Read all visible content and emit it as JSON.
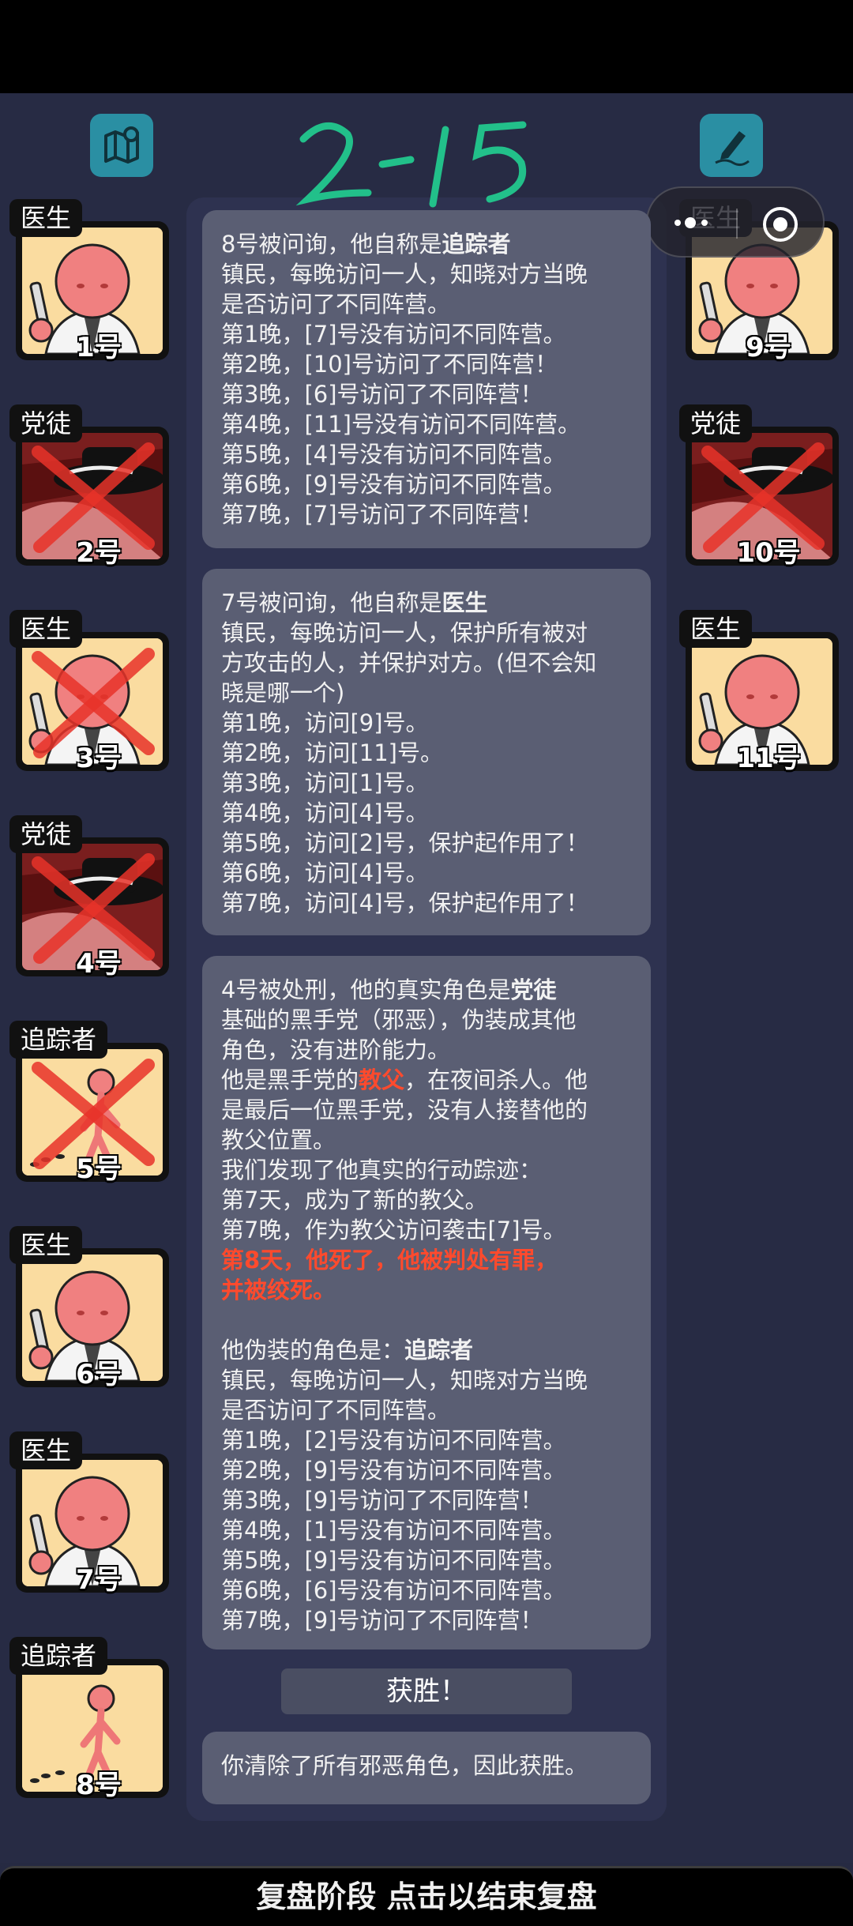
{
  "header": {
    "handwritten_note": "2-15",
    "map_icon": "map-pin-icon",
    "notes_icon": "pencil-note-icon"
  },
  "capsule": {
    "more_icon": "more-dots-icon",
    "close_icon": "target-close-icon"
  },
  "players": [
    {
      "number": "1号",
      "role": "医生",
      "style": "doctor",
      "dead": false
    },
    {
      "number": "2号",
      "role": "党徒",
      "style": "mafia",
      "dead": true
    },
    {
      "number": "3号",
      "role": "医生",
      "style": "doctor",
      "dead": true
    },
    {
      "number": "4号",
      "role": "党徒",
      "style": "mafia",
      "dead": true
    },
    {
      "number": "5号",
      "role": "追踪者",
      "style": "tracker",
      "dead": true
    },
    {
      "number": "6号",
      "role": "医生",
      "style": "doctor",
      "dead": false
    },
    {
      "number": "7号",
      "role": "医生",
      "style": "doctor",
      "dead": false
    },
    {
      "number": "8号",
      "role": "追踪者",
      "style": "tracker",
      "dead": false
    },
    {
      "number": "9号",
      "role": "医生",
      "style": "doctor",
      "dead": false
    },
    {
      "number": "10号",
      "role": "党徒",
      "style": "mafia",
      "dead": true
    },
    {
      "number": "11号",
      "role": "医生",
      "style": "doctor",
      "dead": false
    }
  ],
  "messages": {
    "m1": {
      "intro": "8号被问询，他自称是",
      "role": "追踪者",
      "lines": [
        "镇民，每晚访问一人，知晓对方当晚",
        "是否访问了不同阵营。",
        "第1晚，[7]号没有访问不同阵营。",
        "第2晚，[10]号访问了不同阵营！",
        "第3晚，[6]号访问了不同阵营！",
        "第4晚，[11]号没有访问不同阵营。",
        "第5晚，[4]号没有访问不同阵营。",
        "第6晚，[9]号没有访问不同阵营。",
        "第7晚，[7]号访问了不同阵营！"
      ]
    },
    "m2": {
      "intro": "7号被问询，他自称是",
      "role": "医生",
      "lines": [
        "镇民，每晚访问一人，保护所有被对",
        "方攻击的人，并保护对方。(但不会知",
        "晓是哪一个)",
        "第1晚，访问[9]号。",
        "第2晚，访问[11]号。",
        "第3晚，访问[1]号。",
        "第4晚，访问[4]号。",
        "第5晚，访问[2]号，保护起作用了！",
        "第6晚，访问[4]号。",
        "第7晚，访问[4]号，保护起作用了！"
      ]
    },
    "m3": {
      "intro": "4号被处刑，他的真实角色是",
      "role": "党徒",
      "l1": "基础的黑手党（邪恶），伪装成其他",
      "l2": "角色，没有进阶能力。",
      "l3_pre": "他是黑手党的",
      "l3_red": "教父",
      "l3_post": "，在夜间杀人。他",
      "l4": "是最后一位黑手党，没有人接替他的",
      "l5": "教父位置。",
      "l6": "我们发现了他真实的行动踪迹：",
      "l7": "第7天，成为了新的教父。",
      "l8": "第7晚，作为教父访问袭击[7]号。",
      "red1": "第8天，他死了，他被判处有罪，",
      "red2": "并被绞死。",
      "disguise_intro": "他伪装的角色是：",
      "disguise_role": "追踪者",
      "lines": [
        "镇民，每晚访问一人，知晓对方当晚",
        "是否访问了不同阵营。",
        "第1晚，[2]号没有访问不同阵营。",
        "第2晚，[9]号没有访问不同阵营。",
        "第3晚，[9]号访问了不同阵营！",
        "第4晚，[1]号没有访问不同阵营。",
        "第5晚，[9]号没有访问不同阵营。",
        "第6晚，[6]号没有访问不同阵营。",
        "第7晚，[9]号访问了不同阵营！"
      ]
    },
    "win_title": "获胜！",
    "win_text": "你清除了所有邪恶角色，因此获胜。"
  },
  "footer": {
    "label": "复盘阶段 点击以结束复盘"
  },
  "colors": {
    "accent_teal": "#2a8fa3",
    "highlight_red": "#ff4a2d",
    "bubble": "#5a5e73"
  }
}
